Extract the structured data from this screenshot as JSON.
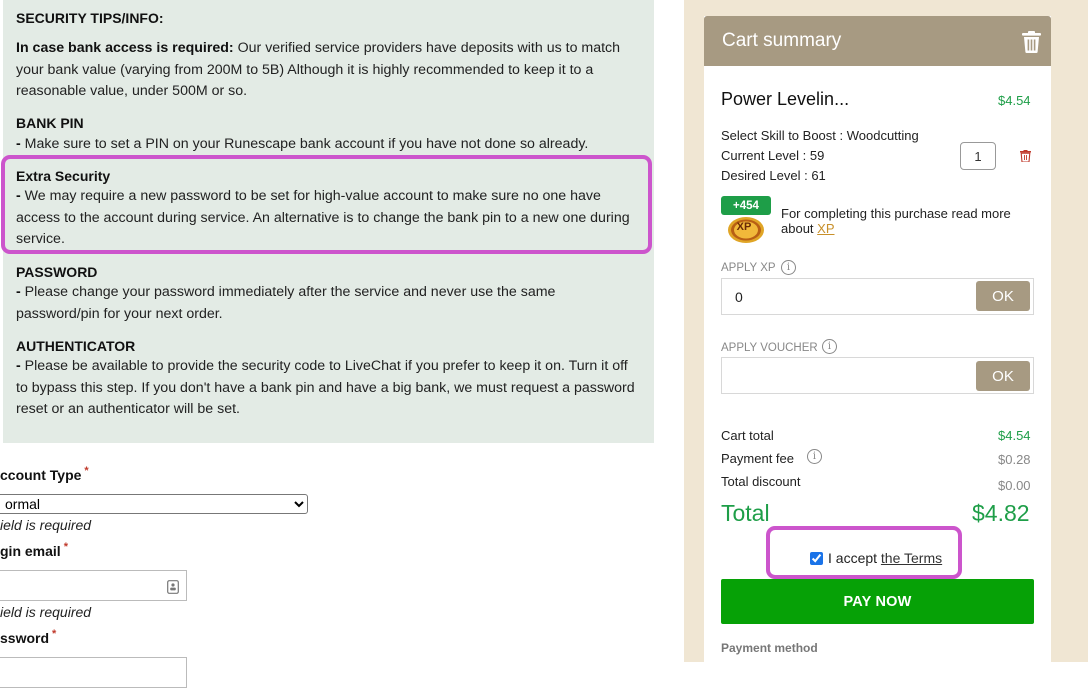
{
  "info": {
    "title": "SECURITY TIPS/INFO:",
    "bank_access_lead": "In case bank access is required:",
    "bank_access_text": " Our verified service providers have deposits with us to match your bank value (varying from 200M to 5B) Although it is highly recommended to keep it to a reasonable value, under 500M or so.",
    "bank_pin_title": "BANK PIN",
    "bank_pin_text": " Make sure to set a PIN on your Runescape bank account if you have not done so already.",
    "extra_security_title": "Extra Security",
    "extra_security_text": " We may require a new password to be set for high-value account to make sure no one have access to the account during service. An alternative is to change the bank pin to a new one during service.",
    "password_title": "PASSWORD",
    "password_text": " Please change your password immediately after the service and never use the same password/pin for your next order.",
    "authenticator_title": "AUTHENTICATOR",
    "authenticator_text": " Please be available to provide the security code to LiveChat if you prefer to keep it on. Turn it off to bypass this step. If you don't have a bank pin and have a big bank, we must request a password reset or an authenticator will be set.",
    "dash": "-"
  },
  "form": {
    "account_type_label": "ccount Type",
    "account_type_value": "ormal",
    "account_type_error": "ield is required",
    "login_email_label": "gin email",
    "login_email_error": "ield is required",
    "password_label": "ssword",
    "required_mark": "*"
  },
  "cart": {
    "title": "Cart summary",
    "item_name": "Power Levelin...",
    "item_price": "$4.54",
    "skill_line": "Select Skill to Boost : Woodcutting",
    "current_level_line": "Current Level : 59",
    "desired_level_line": "Desired Level : 61",
    "quantity": "1",
    "xp_badge": "+454",
    "xp_coin_text": "XP",
    "xp_note_prefix": "For completing this purchase read more about ",
    "xp_note_link": "XP",
    "apply_xp_label": "APPLY XP",
    "apply_xp_value": "0",
    "ok_label": "OK",
    "apply_voucher_label": "APPLY VOUCHER",
    "apply_voucher_value": "",
    "cart_total_label": "Cart total",
    "cart_total_value": "$4.54",
    "payment_fee_label": "Payment fee",
    "payment_fee_value": "$0.28",
    "total_discount_label": "Total discount",
    "total_discount_value": "$0.00",
    "total_label": "Total",
    "total_value": "$4.82",
    "terms_prefix": "I accept ",
    "terms_link": "the Terms",
    "terms_checked": true,
    "pay_label": "PAY NOW",
    "payment_method_label": "Payment method",
    "info_glyph": "i"
  },
  "colors": {
    "highlight": "#cc55cc",
    "accent_green": "#1e9e48",
    "pay_green": "#06a106",
    "header_tan": "#a79a82",
    "info_bg": "#e3ebe5",
    "panel_bg": "#f0e6d3"
  },
  "icons": {
    "trash_header": "trash-icon",
    "trash_item": "trash-icon",
    "info": "info-icon",
    "email_field": "contact-card-icon",
    "xp_coin": "xp-coin-icon"
  }
}
